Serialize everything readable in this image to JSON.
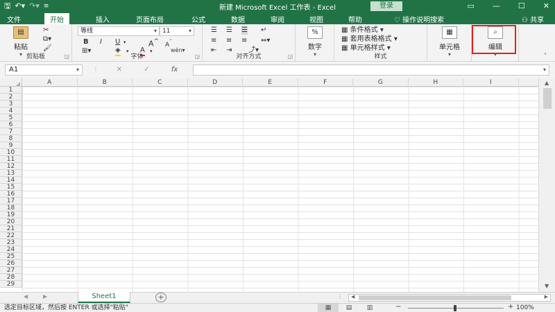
{
  "titlebar": {
    "save_icon": "save-icon",
    "undo_icon": "undo-icon",
    "redo_icon": "redo-icon",
    "title": "新建 Microsoft Excel 工作表 - Excel",
    "login_label": "登录"
  },
  "tabs": [
    {
      "label": "文件"
    },
    {
      "label": "开始"
    },
    {
      "label": "插入"
    },
    {
      "label": "页面布局"
    },
    {
      "label": "公式"
    },
    {
      "label": "数据"
    },
    {
      "label": "审阅"
    },
    {
      "label": "视图"
    },
    {
      "label": "帮助"
    }
  ],
  "tell_me": "操作说明搜索",
  "share": "共享",
  "ribbon": {
    "clipboard": {
      "paste": "粘贴",
      "label": "剪贴板"
    },
    "font": {
      "name": "等线",
      "size": "11",
      "bold": "B",
      "italic": "I",
      "underline": "U",
      "grow": "A",
      "shrink": "A",
      "label": "字体"
    },
    "alignment": {
      "label": "对齐方式"
    },
    "number": {
      "symbol": "%",
      "label": "数字"
    },
    "styles": {
      "conditional": "条件格式",
      "table": "套用表格格式",
      "cell_styles": "单元格样式",
      "label": "样式"
    },
    "cells": {
      "label": "单元格"
    },
    "editing": {
      "label": "编辑"
    }
  },
  "formula_bar": {
    "name_box": "A1",
    "cancel": "✕",
    "enter": "✓",
    "fx": "fx"
  },
  "grid": {
    "columns": [
      "A",
      "B",
      "C",
      "D",
      "E",
      "F",
      "G",
      "H",
      "I"
    ],
    "rows": [
      "1",
      "2",
      "3",
      "4",
      "5",
      "6",
      "7",
      "8",
      "9",
      "10",
      "11",
      "12",
      "13",
      "14",
      "15",
      "16",
      "17",
      "18",
      "19",
      "20",
      "21",
      "22",
      "23",
      "24",
      "25",
      "26",
      "27",
      "28",
      "29"
    ]
  },
  "sheets": [
    {
      "label": "Sheet1"
    }
  ],
  "status": {
    "message": "选定目标区域，然后按 ENTER 或选择\"粘贴\"",
    "zoom": "100%"
  },
  "colors": {
    "accent": "#217346",
    "highlight": "#e3201a"
  }
}
